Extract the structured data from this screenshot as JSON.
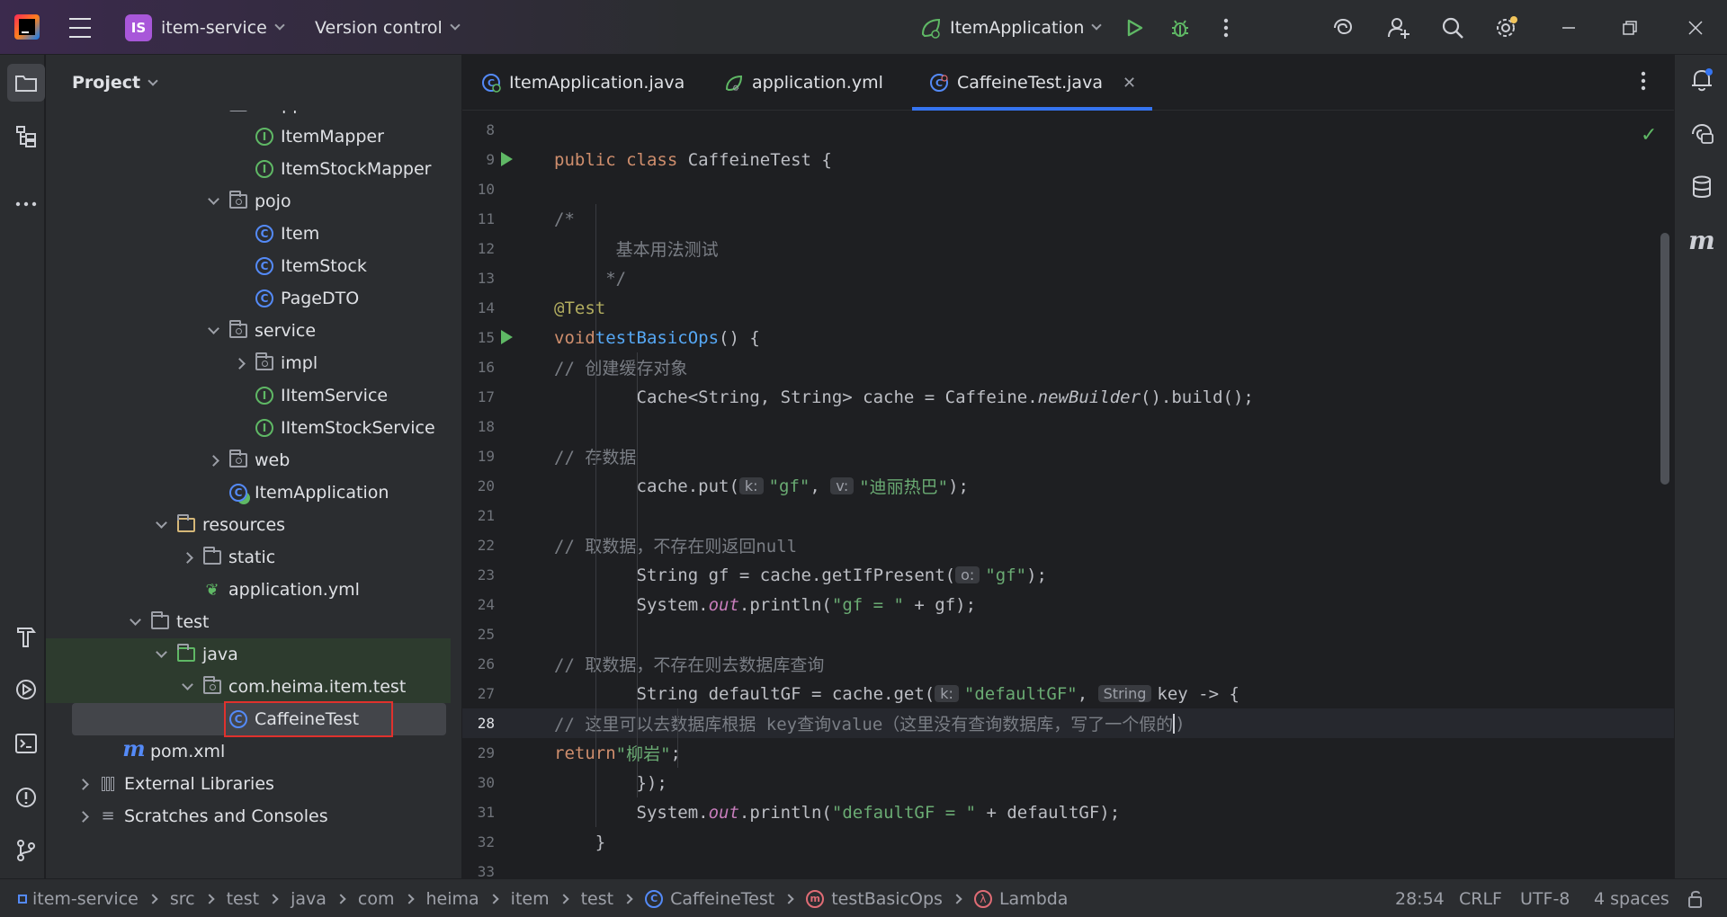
{
  "titlebar": {
    "project_badge": "IS",
    "project_name": "item-service",
    "vcs_label": "Version control",
    "run_config": "ItemApplication"
  },
  "project_panel": {
    "title": "Project",
    "tree": [
      {
        "label": "mapper",
        "type": "package",
        "depth": 6,
        "arrow": "down"
      },
      {
        "label": "ItemMapper",
        "type": "interface",
        "depth": 7
      },
      {
        "label": "ItemStockMapper",
        "type": "interface",
        "depth": 7
      },
      {
        "label": "pojo",
        "type": "package",
        "depth": 6,
        "arrow": "down"
      },
      {
        "label": "Item",
        "type": "class",
        "depth": 7
      },
      {
        "label": "ItemStock",
        "type": "class",
        "depth": 7
      },
      {
        "label": "PageDTO",
        "type": "class",
        "depth": 7
      },
      {
        "label": "service",
        "type": "package",
        "depth": 6,
        "arrow": "down"
      },
      {
        "label": "impl",
        "type": "package",
        "depth": 7,
        "arrow": "right"
      },
      {
        "label": "IItemService",
        "type": "interface",
        "depth": 7
      },
      {
        "label": "IItemStockService",
        "type": "interface",
        "depth": 7
      },
      {
        "label": "web",
        "type": "package",
        "depth": 6,
        "arrow": "right"
      },
      {
        "label": "ItemApplication",
        "type": "springclass",
        "depth": 6
      },
      {
        "label": "resources",
        "type": "resfolder",
        "depth": 4,
        "arrow": "down"
      },
      {
        "label": "static",
        "type": "folder",
        "depth": 5,
        "arrow": "right"
      },
      {
        "label": "application.yml",
        "type": "yml",
        "depth": 5
      },
      {
        "label": "test",
        "type": "folder",
        "depth": 3,
        "arrow": "down"
      },
      {
        "label": "java",
        "type": "testfolder",
        "depth": 4,
        "arrow": "down",
        "highlight": true
      },
      {
        "label": "com.heima.item.test",
        "type": "package",
        "depth": 5,
        "arrow": "down",
        "highlight": true
      },
      {
        "label": "CaffeineTest",
        "type": "class",
        "depth": 6,
        "selected": true
      },
      {
        "label": "pom.xml",
        "type": "maven",
        "depth": 2
      },
      {
        "label": "External Libraries",
        "type": "library",
        "depth": 1,
        "arrow": "right"
      },
      {
        "label": "Scratches and Consoles",
        "type": "scratch",
        "depth": 1,
        "arrow": "right"
      }
    ]
  },
  "tabs": [
    {
      "label": "ItemApplication.java",
      "icon": "spring-class-icon"
    },
    {
      "label": "application.yml",
      "icon": "yml-icon"
    },
    {
      "label": "CaffeineTest.java",
      "icon": "class-icon",
      "active": true
    }
  ],
  "editor": {
    "current_line": 28,
    "lines": [
      {
        "n": "8",
        "html": ""
      },
      {
        "n": "9",
        "html": "<span class='kw'>public class</span> CaffeineTest {",
        "run": true
      },
      {
        "n": "10",
        "html": ""
      },
      {
        "n": "11",
        "html": "    <span class='cm'>/*</span>"
      },
      {
        "n": "12",
        "html": "<span class='cm'>      基本用法测试</span>"
      },
      {
        "n": "13",
        "html": "<span class='cm'>     */</span>"
      },
      {
        "n": "14",
        "html": "    <span class='an'>@Test</span>"
      },
      {
        "n": "15",
        "html": "    <span class='kw'>void</span> <span class='fn'>testBasicOps</span>() {",
        "run": true
      },
      {
        "n": "16",
        "html": "        <span class='cm'>// 创建缓存对象</span>"
      },
      {
        "n": "17",
        "html": "        Cache&lt;String, String&gt; cache = Caffeine.<span class='itf'>newBuilder</span>().build();"
      },
      {
        "n": "18",
        "html": ""
      },
      {
        "n": "19",
        "html": "        <span class='cm'>// 存数据</span>"
      },
      {
        "n": "20",
        "html": "        cache.put(<span class='hint'>k:</span><span class='st'>\"gf\"</span>, <span class='hint'>v:</span><span class='st'>\"迪丽热巴\"</span>);"
      },
      {
        "n": "21",
        "html": ""
      },
      {
        "n": "22",
        "html": "        <span class='cm'>// 取数据，不存在则返回null</span>"
      },
      {
        "n": "23",
        "html": "        String gf = cache.getIfPresent(<span class='hint'>o:</span><span class='st'>\"gf\"</span>);"
      },
      {
        "n": "24",
        "html": "        System.<span class='it'>out</span>.println(<span class='st'>\"gf = \"</span> + gf);"
      },
      {
        "n": "25",
        "html": ""
      },
      {
        "n": "26",
        "html": "        <span class='cm'>// 取数据，不存在则去数据库查询</span>"
      },
      {
        "n": "27",
        "html": "        String defaultGF = cache.get(<span class='hint'>k:</span><span class='st'>\"defaultGF\"</span>, <span class='hint'>String</span>key -&gt; {"
      },
      {
        "n": "28",
        "html": "            <span class='cm'>// 这里可以去数据库根据 key查询value（这里没有查询数据库，写了一个假的</span><span class='caret'></span><span class='cm'>)</span>"
      },
      {
        "n": "29",
        "html": "            <span class='kw'>return</span> <span class='st'>\"柳岩\"</span>;"
      },
      {
        "n": "30",
        "html": "        });"
      },
      {
        "n": "31",
        "html": "        System.<span class='it'>out</span>.println(<span class='st'>\"defaultGF = \"</span> + defaultGF);"
      },
      {
        "n": "32",
        "html": "    }"
      },
      {
        "n": "33",
        "html": ""
      }
    ]
  },
  "statusbar": {
    "breadcrumbs": [
      "item-service",
      "src",
      "test",
      "java",
      "com",
      "heima",
      "item",
      "test",
      "CaffeineTest",
      "testBasicOps",
      "Lambda"
    ],
    "position": "28:54",
    "line_sep": "CRLF",
    "encoding": "UTF-8",
    "indent": "4 spaces"
  },
  "colors": {
    "accent": "#3574f0",
    "run_green": "#5fb865",
    "selection_border": "#e0312d"
  }
}
